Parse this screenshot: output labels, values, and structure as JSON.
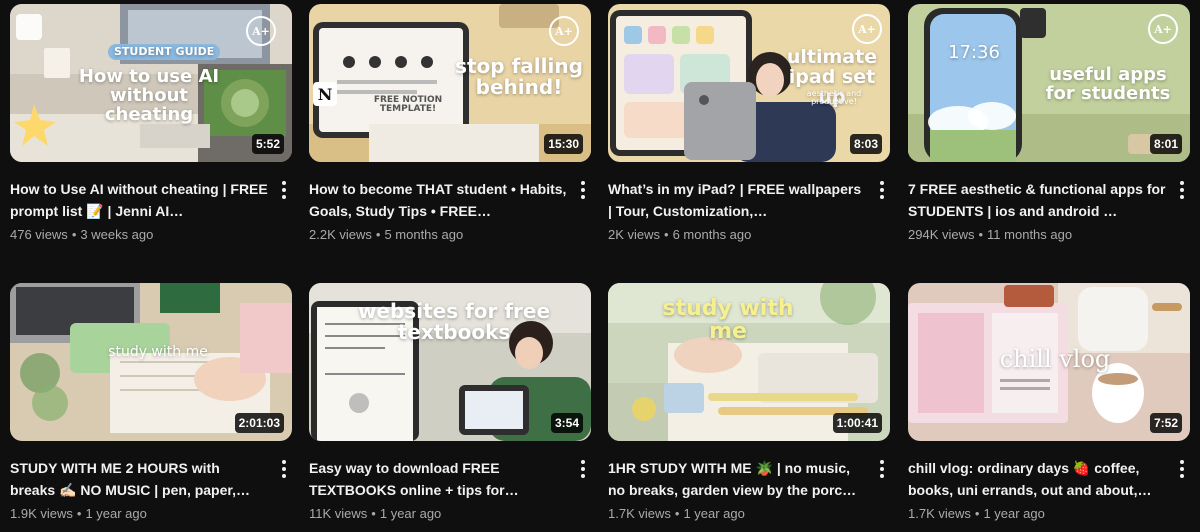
{
  "videos": [
    {
      "title": "How to Use AI without cheating | FREE prompt list 📝 | Jenni AI…",
      "views": "476 views",
      "age": "3 weeks ago",
      "duration": "5:52",
      "thumb_text": "How to use AI without cheating",
      "thumb_tag": "STUDENT GUIDE",
      "colors": {
        "bg": "#c9c2b4",
        "accent": "#7fa35a"
      }
    },
    {
      "title": "How to become THAT student • Habits, Goals, Study Tips • FREE…",
      "views": "2.2K views",
      "age": "5 months ago",
      "duration": "15:30",
      "thumb_text": "stop falling behind!",
      "thumb_tag": "FREE NOTION TEMPLATE!",
      "colors": {
        "bg": "#e7d2a4",
        "accent": "#3a3a3a"
      }
    },
    {
      "title": "What’s in my iPad? | FREE wallpapers | Tour, Customization,…",
      "views": "2K views",
      "age": "6 months ago",
      "duration": "8:03",
      "thumb_text": "ultimate ipad set up",
      "thumb_tag": "aesthetic and productive!",
      "colors": {
        "bg": "#e9d6a3",
        "accent": "#2d2f3a"
      }
    },
    {
      "title": "7 FREE aesthetic & functional apps for STUDENTS | ios and android …",
      "views": "294K views",
      "age": "11 months ago",
      "duration": "8:01",
      "thumb_text": "useful apps for students",
      "thumb_tag": "17:36",
      "colors": {
        "bg": "#bfcf9a",
        "accent": "#7fb6e6"
      }
    },
    {
      "title": "STUDY WITH ME 2 HOURS with breaks ✍🏻 NO MUSIC | pen, paper,…",
      "views": "1.9K views",
      "age": "1 year ago",
      "duration": "2:01:03",
      "thumb_text": "study with me",
      "thumb_tag": "",
      "colors": {
        "bg": "#d9cdb6",
        "accent": "#9ccf8a"
      }
    },
    {
      "title": "Easy way to download FREE TEXTBOOKS online + tips for…",
      "views": "11K views",
      "age": "1 year ago",
      "duration": "3:54",
      "thumb_text": "websites for free textbooks",
      "thumb_tag": "",
      "colors": {
        "bg": "#c9c9bd",
        "accent": "#4d7a4a"
      }
    },
    {
      "title": "1HR STUDY WITH ME 🪴 | no music, no breaks, garden view by the porc…",
      "views": "1.7K views",
      "age": "1 year ago",
      "duration": "1:00:41",
      "thumb_text": "study with me",
      "thumb_tag": "",
      "colors": {
        "bg": "#c8d4b8",
        "accent": "#e8d889"
      }
    },
    {
      "title": "chill vlog: ordinary days 🍓 coffee, books, uni errands, out and about,…",
      "views": "1.7K views",
      "age": "1 year ago",
      "duration": "7:52",
      "thumb_text": "chill vlog",
      "thumb_tag": "",
      "colors": {
        "bg": "#ddc7ba",
        "accent": "#e9a7b6"
      }
    }
  ]
}
